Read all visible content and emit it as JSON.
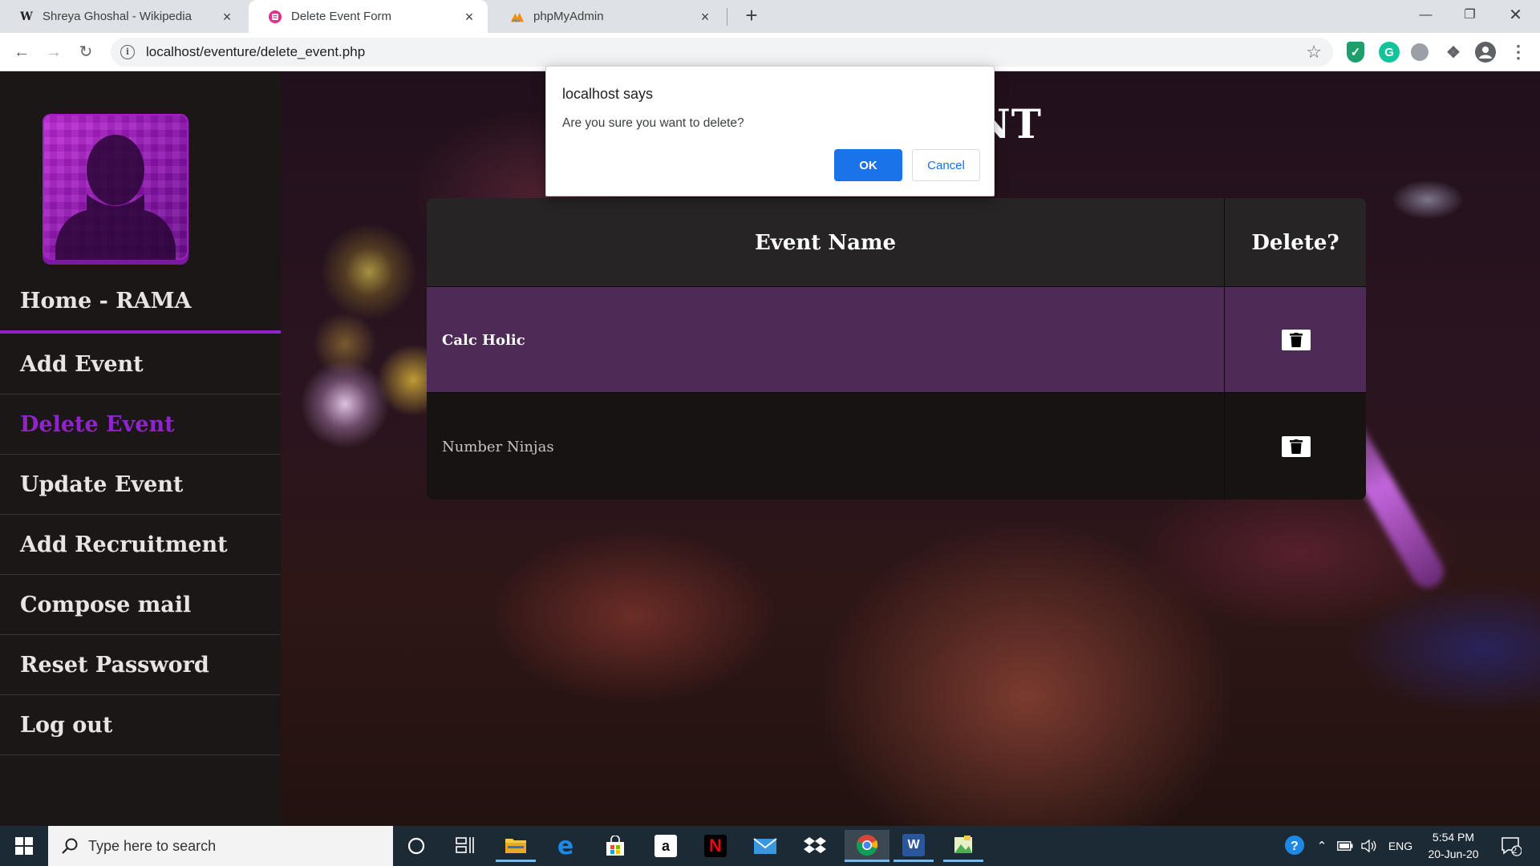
{
  "browser": {
    "tabs": [
      {
        "favicon": "W",
        "label": "Shreya Ghoshal - Wikipedia",
        "active": false
      },
      {
        "favicon": "form-icon",
        "label": "Delete Event Form",
        "active": true
      },
      {
        "favicon": "pma-icon",
        "label": "phpMyAdmin",
        "active": false
      }
    ],
    "url": "localhost/eventure/delete_event.php"
  },
  "sidebar": {
    "items": [
      {
        "label": "Home - RAMA"
      },
      {
        "label": "Add Event"
      },
      {
        "label": "Delete Event"
      },
      {
        "label": "Update Event"
      },
      {
        "label": "Add Recruitment"
      },
      {
        "label": "Compose mail"
      },
      {
        "label": "Reset Password"
      },
      {
        "label": "Log out"
      }
    ],
    "active_index": 2,
    "accent": "#8e24c9"
  },
  "main": {
    "heading_visible_part": "NT",
    "table": {
      "headers": [
        "Event Name",
        "Delete?"
      ],
      "rows": [
        {
          "name": "Calc Holic"
        },
        {
          "name": "Number Ninjas"
        }
      ]
    }
  },
  "dialog": {
    "title": "localhost says",
    "message": "Are you sure you want to delete?",
    "ok_label": "OK",
    "cancel_label": "Cancel"
  },
  "taskbar": {
    "search_placeholder": "Type here to search",
    "language": "ENG",
    "time": "5:54 PM",
    "date": "20-Jun-20",
    "notification_count": "2"
  }
}
